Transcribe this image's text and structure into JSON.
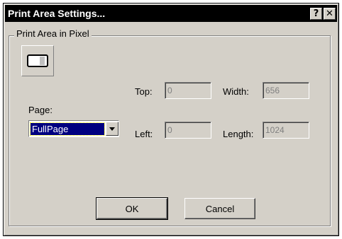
{
  "window": {
    "title": "Print Area Settings...",
    "help_glyph": "?",
    "close_glyph": "✕"
  },
  "group": {
    "label": "Print  Area in Pixel",
    "icon": "page-layout-icon"
  },
  "page": {
    "label": "Page:",
    "selected": "FullPage"
  },
  "fields": {
    "top_label": "Top:",
    "top_value": "0",
    "left_label": "Left:",
    "left_value": "0",
    "width_label": "Width:",
    "width_value": "656",
    "length_label": "Length:",
    "length_value": "1024"
  },
  "buttons": {
    "ok": "OK",
    "cancel": "Cancel"
  }
}
